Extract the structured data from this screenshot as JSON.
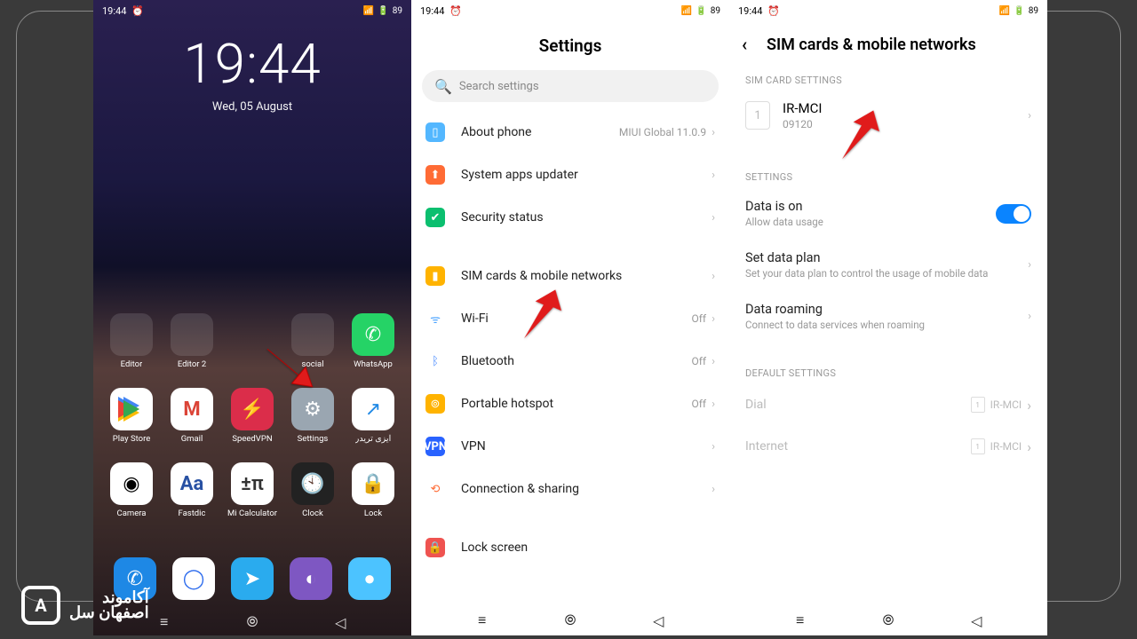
{
  "status": {
    "time": "19:44",
    "battery": "89"
  },
  "home": {
    "clock": "19:44",
    "date": "Wed, 05 August",
    "folders": [
      "Editor",
      "Editor 2",
      "social"
    ],
    "apps_row1": [
      {
        "name": "WhatsApp",
        "key": "whatsapp"
      }
    ],
    "apps_row2": [
      {
        "name": "Play Store",
        "key": "playstore"
      },
      {
        "name": "Gmail",
        "key": "gmail"
      },
      {
        "name": "SpeedVPN",
        "key": "speedvpn"
      },
      {
        "name": "Settings",
        "key": "settings"
      },
      {
        "name": "ایزی تریدر",
        "key": "swoosh"
      }
    ],
    "apps_row3": [
      {
        "name": "Camera",
        "key": "camera"
      },
      {
        "name": "Fastdic",
        "key": "fastdic"
      },
      {
        "name": "Mi Calculator",
        "key": "calc"
      },
      {
        "name": "Clock",
        "key": "clock"
      },
      {
        "name": "Lock",
        "key": "lock"
      }
    ]
  },
  "settings": {
    "title": "Settings",
    "search_placeholder": "Search settings",
    "about": {
      "label": "About phone",
      "value": "MIUI Global 11.0.9"
    },
    "updater": "System apps updater",
    "security": "Security status",
    "sim": "SIM cards & mobile networks",
    "wifi": {
      "label": "Wi-Fi",
      "value": "Off"
    },
    "bt": {
      "label": "Bluetooth",
      "value": "Off"
    },
    "hotspot": {
      "label": "Portable hotspot",
      "value": "Off"
    },
    "vpn": "VPN",
    "cs": "Connection & sharing",
    "lock": "Lock screen"
  },
  "sim": {
    "title": "SIM cards & mobile networks",
    "section1": "SIM CARD SETTINGS",
    "card": {
      "slot": "1",
      "name": "IR-MCI",
      "num": "09120"
    },
    "section2": "SETTINGS",
    "data_on": {
      "title": "Data is on",
      "sub": "Allow data usage"
    },
    "plan": {
      "title": "Set data plan",
      "sub": "Set your data plan to control the usage of mobile data"
    },
    "roaming": {
      "title": "Data roaming",
      "sub": "Connect to data services when roaming"
    },
    "section3": "DEFAULT SETTINGS",
    "dial": {
      "label": "Dial",
      "value": "IR-MCI"
    },
    "internet": {
      "label": "Internet",
      "value": "IR-MCI"
    }
  },
  "watermark": {
    "line1": "آکاموند",
    "line2": "اصفهان سل"
  }
}
